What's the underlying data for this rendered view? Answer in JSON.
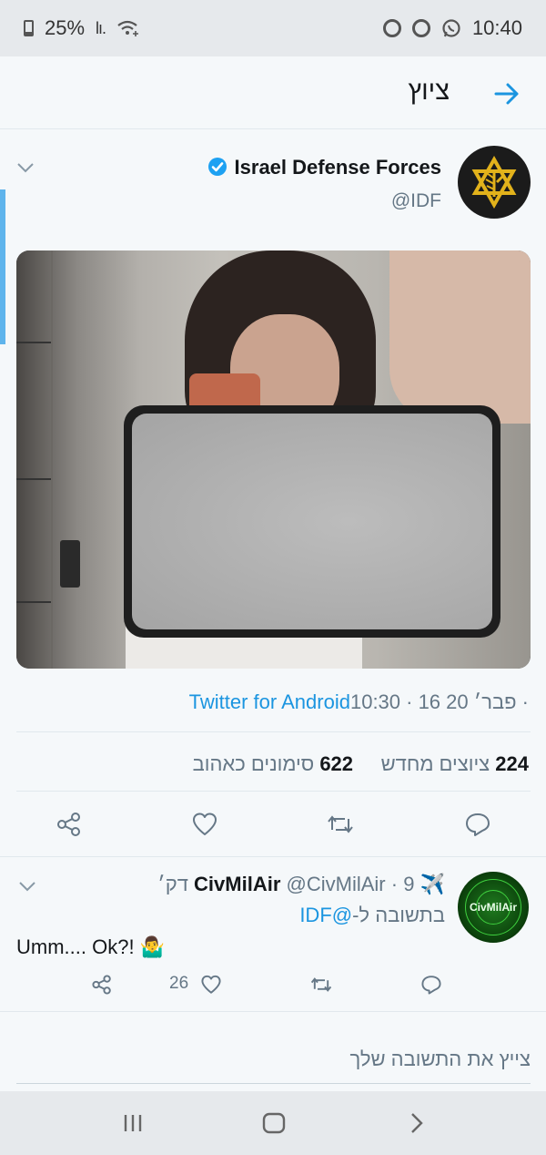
{
  "status_bar": {
    "battery": "25%",
    "signal": "lı.",
    "time": "10:40"
  },
  "header": {
    "title": "ציוץ",
    "back_icon": "arrow-right-icon"
  },
  "tweet": {
    "author_name": "Israel Defense Forces",
    "author_handle": "@IDF",
    "verified": true,
    "meta_time": "10:30 · 16 פבר׳ 20 · ",
    "meta_source": "Twitter for Android",
    "retweets_count": "224",
    "retweets_label": "ציוצים מחדש",
    "likes_count": "622",
    "likes_label": "סימונים כאהוב",
    "colors": {
      "link": "#1b95e0",
      "verified": "#1da1f2"
    }
  },
  "reply": {
    "author_name": "CivMilAir",
    "author_handle": "@CivMilAir",
    "time": "9 דק׳",
    "avatar_text": "CivMilAir",
    "reply_to_label": "בתשובה ל-",
    "reply_to_handle": "@IDF",
    "text": "Umm.... Ok?! 🤷‍♂️",
    "like_count": "26"
  },
  "compose": {
    "placeholder": "צייץ את התשובה שלך"
  }
}
